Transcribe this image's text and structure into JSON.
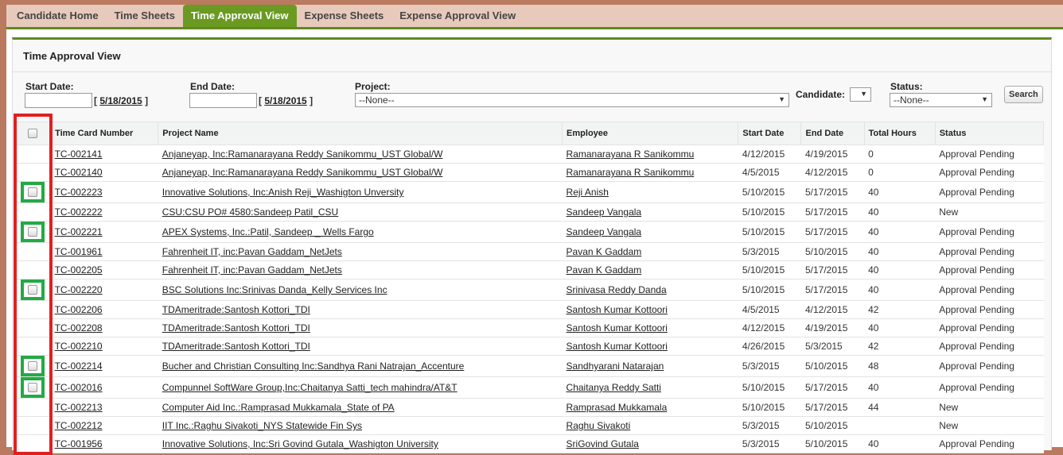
{
  "tabs": [
    "Candidate Home",
    "Time Sheets",
    "Time Approval View",
    "Expense Sheets",
    "Expense Approval View"
  ],
  "active_tab": 2,
  "panel_title": "Time Approval View",
  "filters": {
    "start_label": "Start Date:",
    "start_value": "",
    "start_today": "5/18/2015",
    "end_label": "End Date:",
    "end_value": "",
    "end_today": "5/18/2015",
    "project_label": "Project:",
    "project_value": "--None--",
    "candidate_label": "Candidate:",
    "candidate_value": "",
    "status_label": "Status:",
    "status_value": "--None--",
    "search_label": "Search"
  },
  "columns": [
    "Time Card Number",
    "Project Name",
    "Employee",
    "Start Date",
    "End Date",
    "Total Hours",
    "Status"
  ],
  "rows": [
    [
      "TC-002141",
      "Anjaneyap, Inc:Ramanarayana Reddy Sanikommu_UST Global/W",
      "Ramanarayana R Sanikommu",
      "4/12/2015",
      "4/19/2015",
      "0",
      "Approval Pending",
      false
    ],
    [
      "TC-002140",
      "Anjaneyap, Inc:Ramanarayana Reddy Sanikommu_UST Global/W",
      "Ramanarayana R Sanikommu",
      "4/5/2015",
      "4/12/2015",
      "0",
      "Approval Pending",
      false
    ],
    [
      "TC-002223",
      "Innovative Solutions, Inc:Anish Reji_Washigton Unversity",
      "Reji Anish",
      "5/10/2015",
      "5/17/2015",
      "40",
      "Approval Pending",
      true
    ],
    [
      "TC-002222",
      "CSU:CSU PO# 4580:Sandeep Patil_CSU",
      "Sandeep Vangala",
      "5/10/2015",
      "5/17/2015",
      "40",
      "New",
      false
    ],
    [
      "TC-002221",
      "APEX Systems, Inc.:Patil, Sandeep _ Wells Fargo",
      "Sandeep Vangala",
      "5/10/2015",
      "5/17/2015",
      "40",
      "Approval Pending",
      true
    ],
    [
      "TC-001961",
      "Fahrenheit IT, inc:Pavan Gaddam_NetJets",
      "Pavan K Gaddam",
      "5/3/2015",
      "5/10/2015",
      "40",
      "Approval Pending",
      false
    ],
    [
      "TC-002205",
      "Fahrenheit IT, inc:Pavan Gaddam_NetJets",
      "Pavan K Gaddam",
      "5/10/2015",
      "5/17/2015",
      "40",
      "Approval Pending",
      false
    ],
    [
      "TC-002220",
      "BSC Solutions Inc:Srinivas Danda_Kelly Services Inc",
      "Srinivasa Reddy Danda",
      "5/10/2015",
      "5/17/2015",
      "40",
      "Approval Pending",
      true
    ],
    [
      "TC-002206",
      "TDAmeritrade:Santosh Kottori_TDI",
      "Santosh Kumar Kottoori",
      "4/5/2015",
      "4/12/2015",
      "42",
      "Approval Pending",
      false
    ],
    [
      "TC-002208",
      "TDAmeritrade:Santosh Kottori_TDI",
      "Santosh Kumar Kottoori",
      "4/12/2015",
      "4/19/2015",
      "40",
      "Approval Pending",
      false
    ],
    [
      "TC-002210",
      "TDAmeritrade:Santosh Kottori_TDI",
      "Santosh Kumar Kottoori",
      "4/26/2015",
      "5/3/2015",
      "42",
      "Approval Pending",
      false
    ],
    [
      "TC-002214",
      "Bucher and Christian Consulting Inc:Sandhya Rani Natrajan_Accenture",
      "Sandhyarani Natarajan",
      "5/3/2015",
      "5/10/2015",
      "48",
      "Approval Pending",
      true
    ],
    [
      "TC-002016",
      "Compunnel SoftWare Group,Inc:Chaitanya Satti_tech mahindra/AT&T",
      "Chaitanya Reddy Satti",
      "5/10/2015",
      "5/17/2015",
      "40",
      "Approval Pending",
      true
    ],
    [
      "TC-002213",
      "Computer Aid Inc.:Ramprasad Mukkamala_State of PA",
      "Ramprasad Mukkamala",
      "5/10/2015",
      "5/17/2015",
      "44",
      "New",
      false
    ],
    [
      "TC-002212",
      "IIT Inc.:Raghu Sivakoti_NYS Statewide Fin Sys",
      "Raghu Sivakoti",
      "5/3/2015",
      "5/10/2015",
      "",
      "New",
      false
    ],
    [
      "TC-001956",
      "Innovative Solutions, Inc:Sri Govind Gutala_Washigton University",
      "SriGovind Gutala",
      "5/3/2015",
      "5/10/2015",
      "40",
      "Approval Pending",
      false
    ]
  ]
}
